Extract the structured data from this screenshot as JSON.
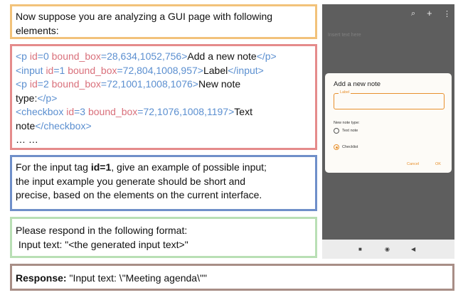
{
  "intro": {
    "line1": "Now suppose you are analyzing a GUI page with following",
    "line2": "elements:"
  },
  "elements": {
    "e0": {
      "open": "<p ",
      "k1": "id",
      "v1": "=0 ",
      "k2": "bound_box",
      "v2": "=28,634,1052,756",
      "gt": ">",
      "text": "Add a new note",
      "close": "</p>"
    },
    "e1": {
      "open": "<input ",
      "k1": "id",
      "v1": "=1 ",
      "k2": "bound_box",
      "v2": "=72,804,1008,957",
      "gt": ">",
      "text": "Label",
      "close": "</input>"
    },
    "e2": {
      "open": "<p ",
      "k1": "id",
      "v1": "=2 ",
      "k2": "bound_box",
      "v2": "=72,1001,1008,1076",
      "gt": ">",
      "text_a": "New note",
      "text_b": "type:",
      "close": "</p>"
    },
    "e3": {
      "open": "<checkbox ",
      "k1": "id",
      "v1": "=3 ",
      "k2": "bound_box",
      "v2": "=72,1076,1008,1197",
      "gt": ">",
      "text_a": "Text",
      "text_b": "note",
      "close": "</checkbox>"
    },
    "ellipsis": "… …"
  },
  "task": {
    "pre": "For the input tag ",
    "bold": "id=1",
    "post": ", give an example of possible input;",
    "line2": "the input example you generate should be short and",
    "line3": "precise, based on the elements on the current interface."
  },
  "format": {
    "line1": "Please respond in the following format:",
    "line2": " Input text: \"<the generated input text>\""
  },
  "response": {
    "label": "Response:",
    "text": " \"Input text: \\\"Meeting agenda\\\"\""
  },
  "phone": {
    "insert_placeholder": "Insert text here",
    "dialog_title": "Add a new note",
    "field_label": "Label",
    "note_type": "New note type:",
    "option_text": "Text note",
    "option_check": "Checklist",
    "cancel": "Cancel",
    "ok": "OK",
    "icons": {
      "search": "⌕",
      "add": "+",
      "more": "⋮",
      "square": "■",
      "circle": "◉",
      "back": "◀"
    }
  }
}
